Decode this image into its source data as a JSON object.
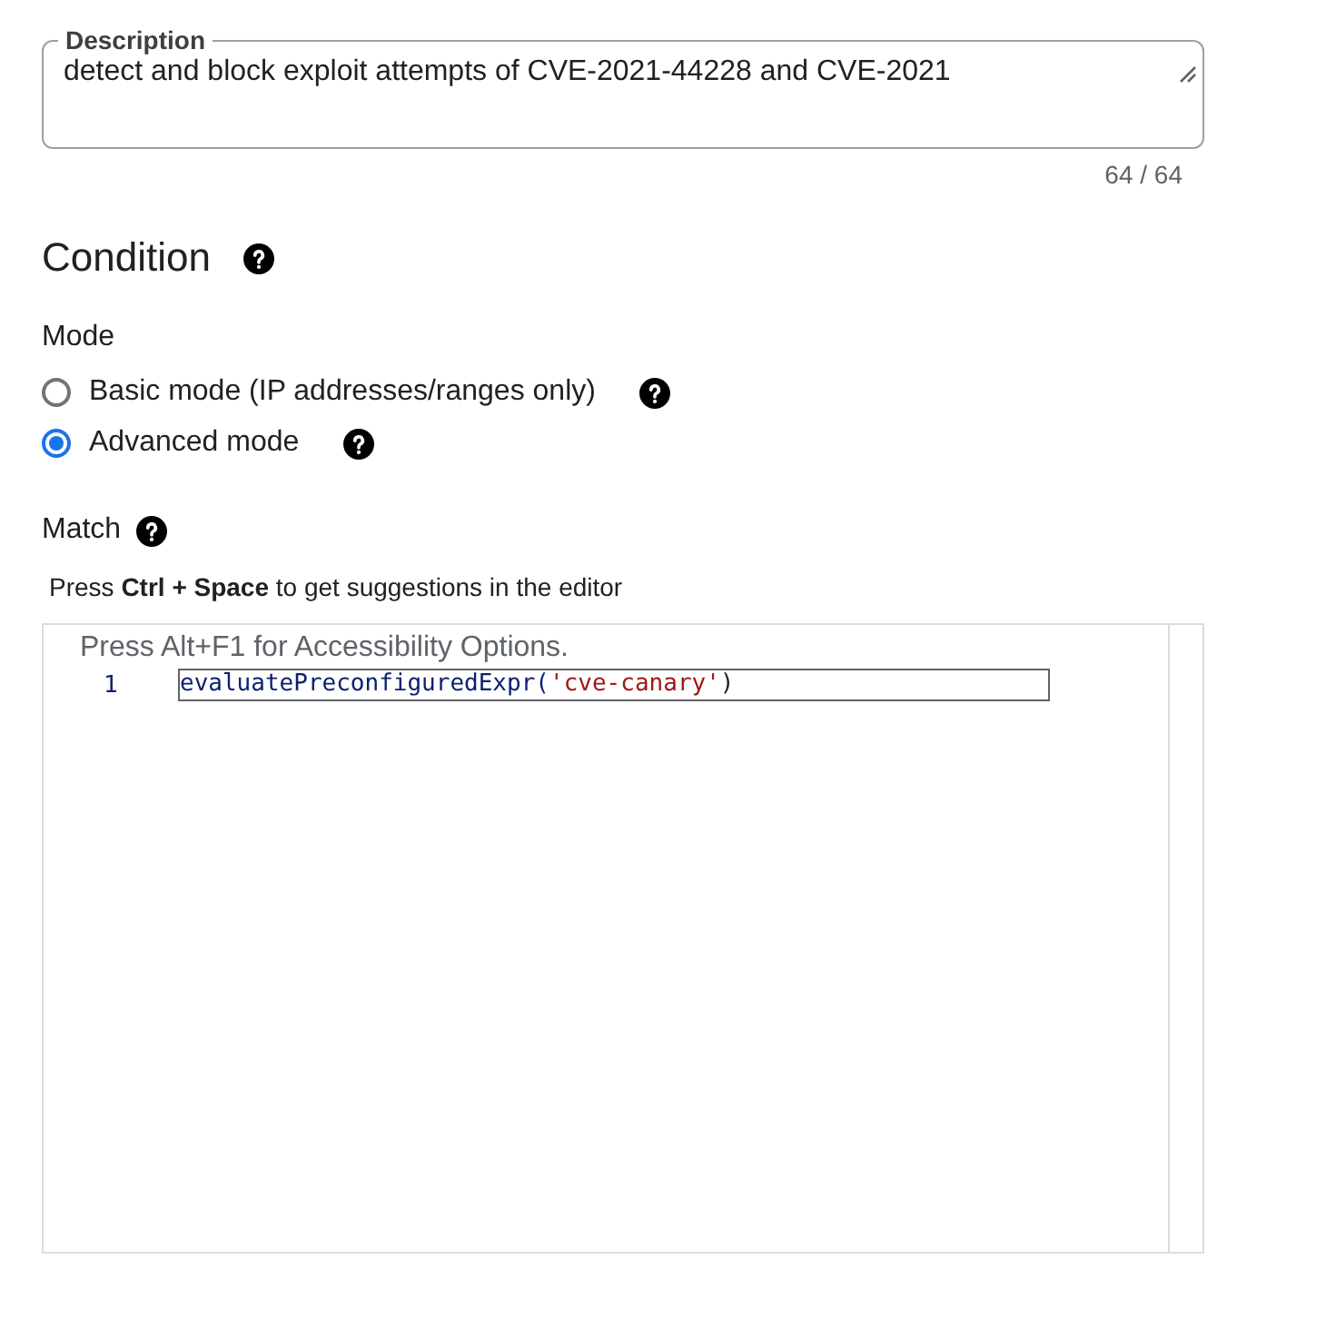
{
  "description": {
    "label": "Description",
    "value": "detect and block exploit attempts of CVE-2021-44228 and CVE-2021",
    "counter": "64 / 64"
  },
  "condition": {
    "title": "Condition"
  },
  "mode": {
    "label": "Mode",
    "options": [
      {
        "label": "Basic mode (IP addresses/ranges only)",
        "selected": false
      },
      {
        "label": "Advanced mode",
        "selected": true
      }
    ]
  },
  "match": {
    "label": "Match",
    "hint": "Press **Ctrl + Space** to get suggestions in the editor"
  },
  "editor": {
    "accessibility_hint": "Press Alt+F1 for Accessibility Options.",
    "lines": [
      {
        "number": "1",
        "tokens": [
          {
            "kind": "function",
            "text": "evaluatePreconfiguredExpr("
          },
          {
            "kind": "string",
            "text": "'cve-canary'"
          },
          {
            "kind": "punct",
            "text": ")"
          }
        ]
      }
    ]
  }
}
